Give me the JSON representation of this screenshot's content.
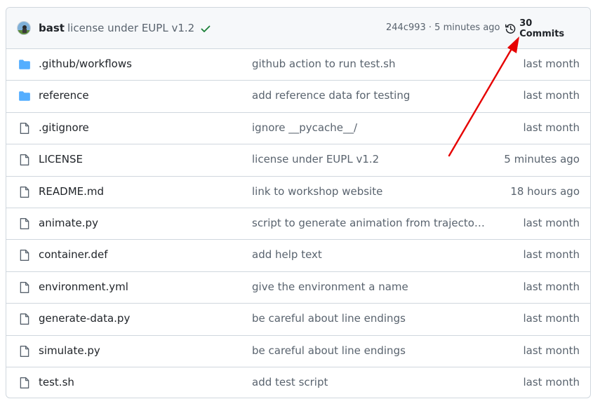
{
  "header": {
    "author": "bast",
    "message": "license under EUPL v1.2",
    "meta": "244c993 · 5 minutes ago",
    "commits_label": "30 Commits"
  },
  "files": [
    {
      "type": "folder",
      "name": ".github/workflows",
      "message": "github action to run test.sh",
      "age": "last month"
    },
    {
      "type": "folder",
      "name": "reference",
      "message": "add reference data for testing",
      "age": "last month"
    },
    {
      "type": "file",
      "name": ".gitignore",
      "message": "ignore __pycache__/",
      "age": "last month"
    },
    {
      "type": "file",
      "name": "LICENSE",
      "message": "license under EUPL v1.2",
      "age": "5 minutes ago"
    },
    {
      "type": "file",
      "name": "README.md",
      "message": "link to workshop website",
      "age": "18 hours ago"
    },
    {
      "type": "file",
      "name": "animate.py",
      "message": "script to generate animation from trajectori…",
      "age": "last month"
    },
    {
      "type": "file",
      "name": "container.def",
      "message": "add help text",
      "age": "last month"
    },
    {
      "type": "file",
      "name": "environment.yml",
      "message": "give the environment a name",
      "age": "last month"
    },
    {
      "type": "file",
      "name": "generate-data.py",
      "message": "be careful about line endings",
      "age": "last month"
    },
    {
      "type": "file",
      "name": "simulate.py",
      "message": "be careful about line endings",
      "age": "last month"
    },
    {
      "type": "file",
      "name": "test.sh",
      "message": "add test script",
      "age": "last month"
    }
  ],
  "colors": {
    "folder": "#54aeff",
    "check": "#1a7f37",
    "arrow": "#e60000"
  },
  "icons": {
    "folder": "folder-icon",
    "file": "file-icon",
    "history": "history-icon",
    "check": "check-icon"
  }
}
